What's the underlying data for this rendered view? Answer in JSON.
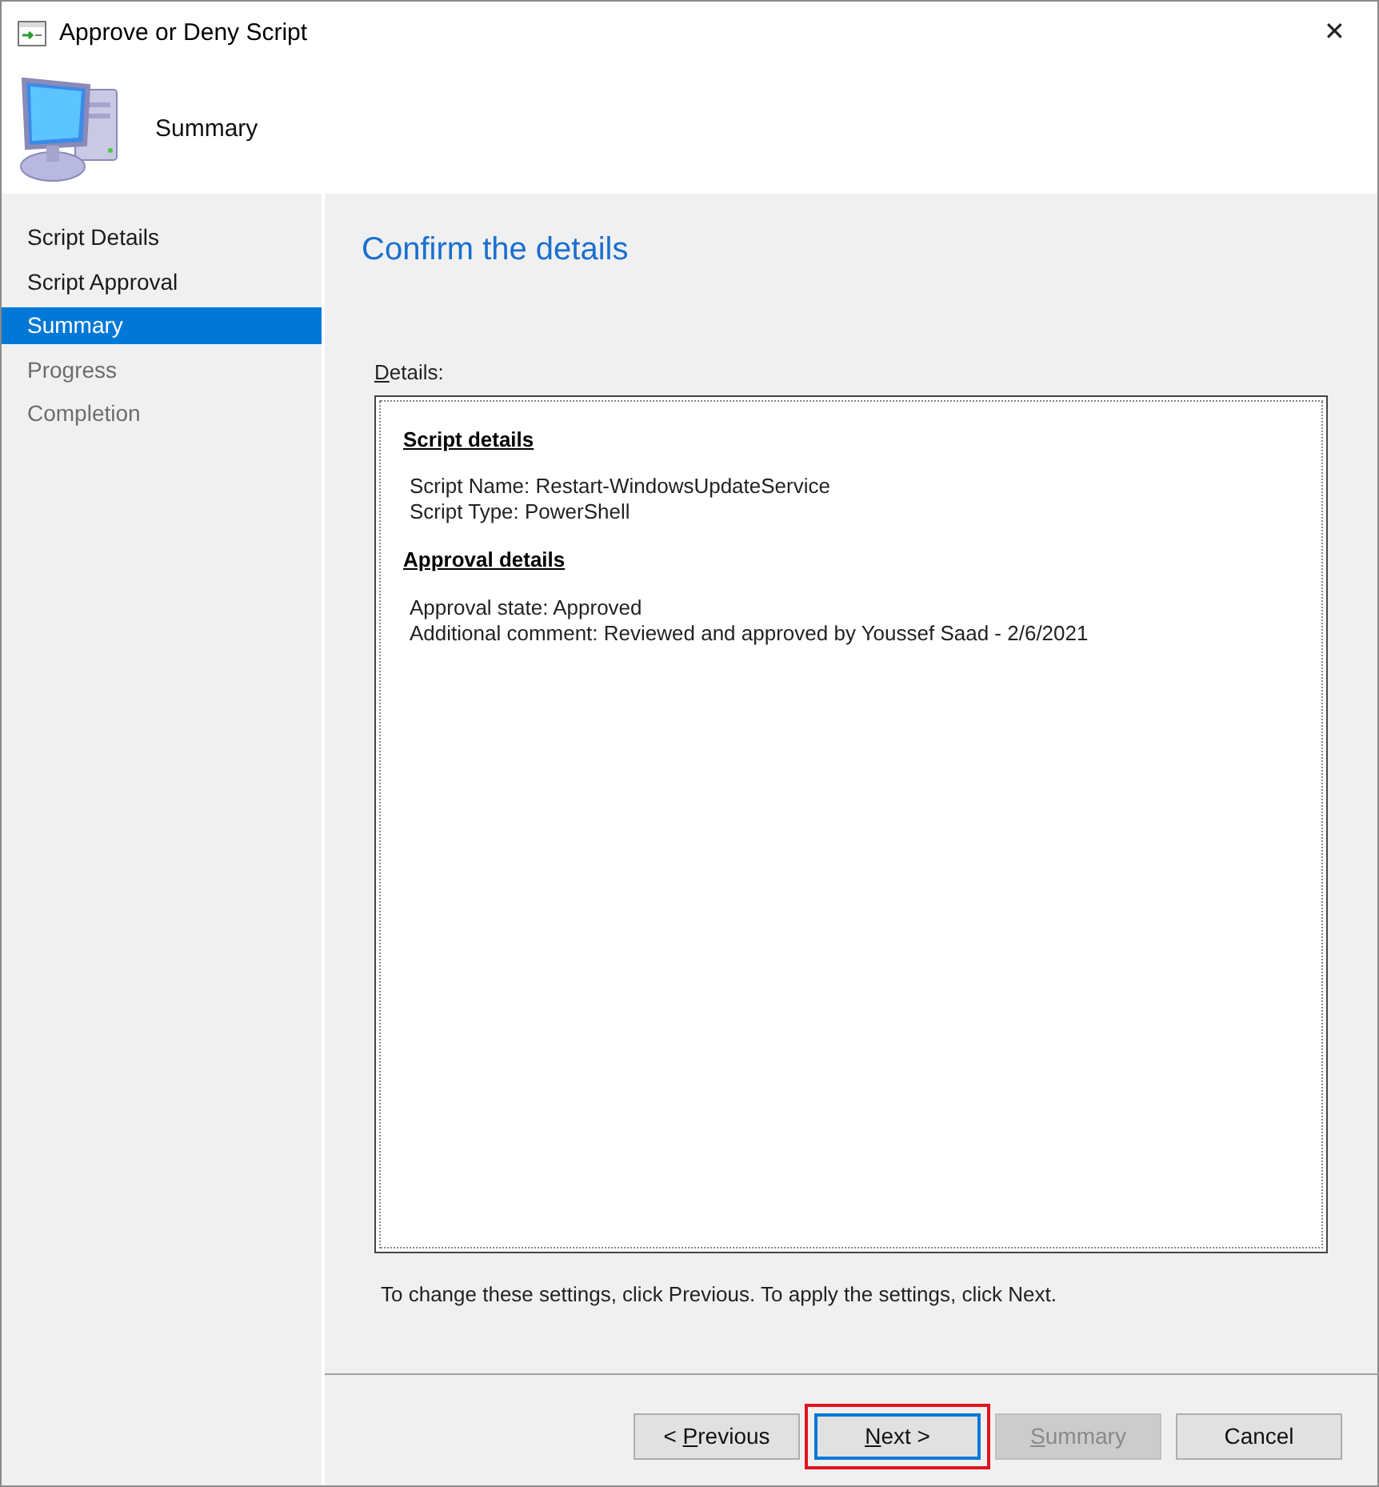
{
  "window": {
    "title": "Approve or Deny Script",
    "close": "✕"
  },
  "header": {
    "title": "Summary"
  },
  "steps": [
    {
      "label": "Script Details",
      "selected": false,
      "disabled": false
    },
    {
      "label": "Script Approval",
      "selected": false,
      "disabled": false
    },
    {
      "label": "Summary",
      "selected": true,
      "disabled": false
    },
    {
      "label": "Progress",
      "selected": false,
      "disabled": true
    },
    {
      "label": "Completion",
      "selected": false,
      "disabled": true
    }
  ],
  "page": {
    "heading": "Confirm the details",
    "details_label": {
      "key": "D",
      "after": "etails:"
    },
    "sections": [
      {
        "heading": "Script details",
        "lines": [
          "Script Name: Restart-WindowsUpdateService",
          "Script Type: PowerShell"
        ]
      },
      {
        "heading": "Approval details",
        "lines": [
          "Approval state: Approved",
          "Additional comment: Reviewed and approved by Youssef Saad - 2/6/2021"
        ]
      }
    ],
    "hint": "To change these settings, click Previous. To apply the settings, click Next."
  },
  "buttons": [
    {
      "label": {
        "before": "< ",
        "key": "P",
        "after": "revious"
      },
      "disabled": false,
      "default": false,
      "highlighted": false
    },
    {
      "label": {
        "key": "N",
        "after": "ext >"
      },
      "disabled": false,
      "default": true,
      "highlighted": true
    },
    {
      "label": {
        "key": "S",
        "after": "ummary"
      },
      "disabled": true,
      "default": false,
      "highlighted": false
    },
    {
      "label": {
        "before": "Cancel"
      },
      "disabled": false,
      "default": false,
      "highlighted": false
    }
  ]
}
